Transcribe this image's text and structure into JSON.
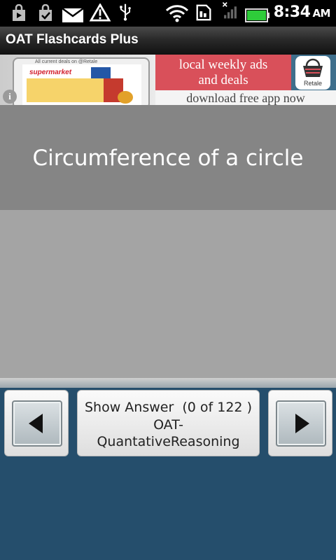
{
  "status_bar": {
    "time": "8:34",
    "ampm": "AM",
    "left_icons": [
      "shopping-bag-icon",
      "shopping-bag-check-icon",
      "mail-icon",
      "warning-icon",
      "usb-icon"
    ],
    "right_icons": [
      "wifi-icon",
      "sim-icon",
      "no-signal-icon",
      "battery-icon"
    ],
    "battery_color": "#2ecc3a"
  },
  "app": {
    "title": "OAT Flashcards Plus"
  },
  "ad": {
    "line1": "local weekly ads",
    "line2": "and deals",
    "line3": "download free app now",
    "logo_text": "Retale",
    "tablet_caption": "All current deals on @Retale",
    "flyer_name": "supermarket",
    "info_label": "i",
    "accent_color": "#d9505a"
  },
  "card": {
    "question": "Circumference of a circle",
    "top_color": "#858585",
    "body_color": "#a4a4a4"
  },
  "controls": {
    "show_answer_label": "Show Answer  (0 of 122 )",
    "deck_line1": "OAT-",
    "deck_line2": "QuantativeReasoning",
    "prev_icon": "arrow-left-icon",
    "next_icon": "arrow-right-icon"
  },
  "colors": {
    "background": "#254e6c"
  }
}
